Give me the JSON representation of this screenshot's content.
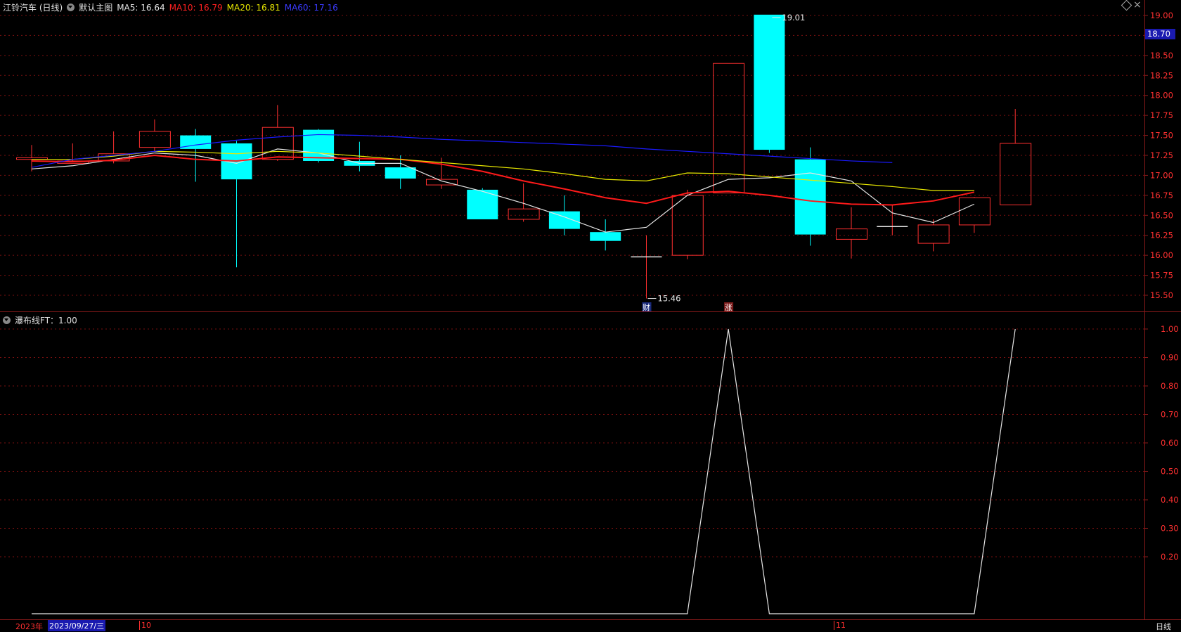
{
  "header": {
    "title": "江铃汽车 (日线)",
    "template": "默认主图",
    "ma5_label": "MA5: 16.64",
    "ma10_label": "MA10: 16.79",
    "ma20_label": "MA20: 16.81",
    "ma60_label": "MA60: 17.16",
    "indicator_label": "瀑布线FT：1.00"
  },
  "colors": {
    "up": "#ff3030",
    "down": "#00ffff",
    "ma5": "#e6e6e6",
    "ma10": "#ff1a1a",
    "ma20": "#e8e800",
    "ma60": "#1a1aff",
    "grid": "#7a1010",
    "axis_text": "#ff3030",
    "indicator": "#e6e6e6"
  },
  "price_axis": {
    "ticks": [
      "19.00",
      "18.75",
      "18.50",
      "18.25",
      "18.00",
      "17.75",
      "17.50",
      "17.25",
      "17.00",
      "16.75",
      "16.50",
      "16.25",
      "16.00",
      "15.75",
      "15.50"
    ],
    "current_price_tag": "18.70",
    "high_marker": "19.01",
    "low_marker": "15.46",
    "event_tags": [
      "财",
      "涨"
    ]
  },
  "chart_data": [
    {
      "type": "candlestick",
      "ylim": [
        15.4,
        19.05
      ],
      "candles": [
        {
          "o": 17.2,
          "h": 17.38,
          "l": 17.05,
          "c": 17.22
        },
        {
          "o": 17.15,
          "h": 17.4,
          "l": 17.15,
          "c": 17.18
        },
        {
          "o": 17.18,
          "h": 17.55,
          "l": 17.15,
          "c": 17.27
        },
        {
          "o": 17.35,
          "h": 17.7,
          "l": 17.3,
          "c": 17.55
        },
        {
          "o": 17.5,
          "h": 17.58,
          "l": 16.92,
          "c": 17.33
        },
        {
          "o": 17.4,
          "h": 17.43,
          "l": 15.85,
          "c": 16.95
        },
        {
          "o": 17.2,
          "h": 17.88,
          "l": 17.18,
          "c": 17.6
        },
        {
          "o": 17.57,
          "h": 17.58,
          "l": 17.16,
          "c": 17.18
        },
        {
          "o": 17.18,
          "h": 17.42,
          "l": 17.05,
          "c": 17.12
        },
        {
          "o": 17.1,
          "h": 17.25,
          "l": 16.83,
          "c": 16.96
        },
        {
          "o": 16.88,
          "h": 17.22,
          "l": 16.83,
          "c": 16.95
        },
        {
          "o": 16.82,
          "h": 16.84,
          "l": 16.45,
          "c": 16.45
        },
        {
          "o": 16.45,
          "h": 16.9,
          "l": 16.42,
          "c": 16.58
        },
        {
          "o": 16.55,
          "h": 16.75,
          "l": 16.25,
          "c": 16.33
        },
        {
          "o": 16.29,
          "h": 16.45,
          "l": 16.06,
          "c": 16.18
        },
        {
          "o": 15.98,
          "h": 16.25,
          "l": 15.46,
          "c": 15.98
        },
        {
          "o": 16.0,
          "h": 16.82,
          "l": 15.95,
          "c": 16.75
        },
        {
          "o": 16.78,
          "h": 18.4,
          "l": 16.78,
          "c": 18.4
        },
        {
          "o": 19.01,
          "h": 19.01,
          "l": 17.28,
          "c": 17.32
        },
        {
          "o": 17.2,
          "h": 17.35,
          "l": 16.12,
          "c": 16.26
        },
        {
          "o": 16.2,
          "h": 16.6,
          "l": 15.96,
          "c": 16.33
        },
        {
          "o": 16.36,
          "h": 16.63,
          "l": 16.25,
          "c": 16.36
        },
        {
          "o": 16.15,
          "h": 16.45,
          "l": 16.05,
          "c": 16.38
        },
        {
          "o": 16.38,
          "h": 16.73,
          "l": 16.28,
          "c": 16.72
        },
        {
          "o": 16.63,
          "h": 17.83,
          "l": 16.63,
          "c": 17.4
        }
      ],
      "series": [
        {
          "name": "MA5",
          "values": [
            17.08,
            17.12,
            17.2,
            17.28,
            17.25,
            17.15,
            17.33,
            17.28,
            17.15,
            17.15,
            16.93,
            16.8,
            16.65,
            16.48,
            16.29,
            16.35,
            16.75,
            16.95,
            16.97,
            17.03,
            16.93,
            16.53,
            16.41,
            16.64
          ]
        },
        {
          "name": "MA10",
          "values": [
            17.18,
            17.17,
            17.19,
            17.25,
            17.2,
            17.18,
            17.23,
            17.22,
            17.21,
            17.2,
            17.14,
            17.05,
            16.93,
            16.83,
            16.72,
            16.65,
            16.78,
            16.8,
            16.75,
            16.68,
            16.64,
            16.63,
            16.68,
            16.79
          ]
        },
        {
          "name": "MA20",
          "values": [
            17.2,
            17.2,
            17.24,
            17.3,
            17.29,
            17.27,
            17.3,
            17.28,
            17.24,
            17.2,
            17.16,
            17.12,
            17.08,
            17.02,
            16.95,
            16.93,
            17.03,
            17.02,
            16.98,
            16.94,
            16.9,
            16.86,
            16.81,
            16.81
          ]
        },
        {
          "name": "MA60",
          "values": [
            17.1,
            17.2,
            17.25,
            17.3,
            17.38,
            17.44,
            17.48,
            17.51,
            17.5,
            17.48,
            17.45,
            17.43,
            17.41,
            17.39,
            17.37,
            17.33,
            17.3,
            17.27,
            17.24,
            17.21,
            17.18,
            17.16
          ]
        }
      ]
    },
    {
      "type": "line",
      "ylim": [
        0,
        1.05
      ],
      "y_ticks": [
        "1.00",
        "0.90",
        "0.80",
        "0.70",
        "0.60",
        "0.50",
        "0.40",
        "0.30",
        "0.20"
      ],
      "series": [
        {
          "name": "瀑布线FT",
          "points": [
            [
              0,
              0
            ],
            [
              16,
              0
            ],
            [
              17,
              1
            ],
            [
              18,
              0
            ],
            [
              23,
              0
            ],
            [
              24,
              1
            ]
          ]
        }
      ]
    }
  ],
  "timeline": {
    "year_label": "2023年",
    "cursor_date": "2023/09/27/三",
    "month_labels": [
      "10",
      "11"
    ],
    "period": "日线"
  }
}
